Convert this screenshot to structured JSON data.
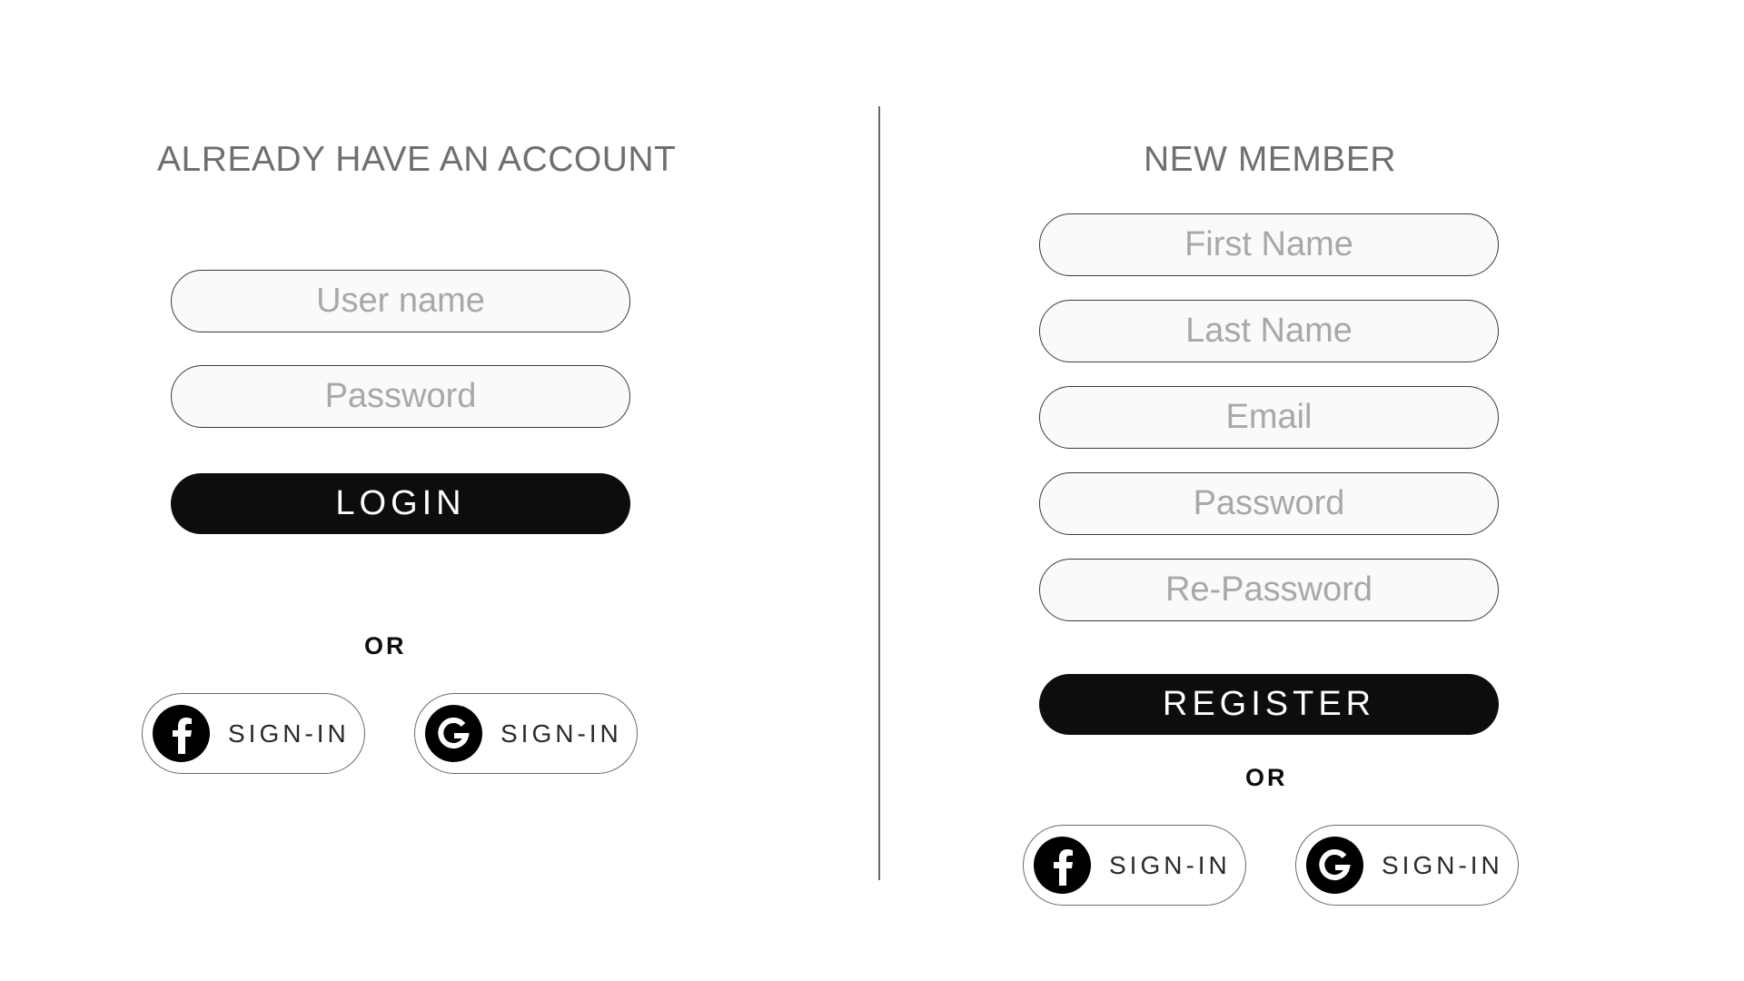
{
  "login": {
    "heading": "ALREADY HAVE AN ACCOUNT",
    "username_placeholder": "User name",
    "password_placeholder": "Password",
    "login_label": "LOGIN",
    "or_label": "OR",
    "facebook_label": "SIGN-IN",
    "google_label": "SIGN-IN"
  },
  "register": {
    "heading": "NEW MEMBER",
    "first_name_placeholder": "First Name",
    "last_name_placeholder": "Last Name",
    "email_placeholder": "Email",
    "password_placeholder": "Password",
    "repassword_placeholder": "Re-Password",
    "register_label": "REGISTER",
    "or_label": "OR",
    "facebook_label": "SIGN-IN",
    "google_label": "SIGN-IN"
  },
  "icons": {
    "facebook": "facebook-icon",
    "google": "google-icon"
  },
  "colors": {
    "primary_button": "#0d0d0d",
    "field_background": "#fbfaf8",
    "heading_text": "#6f6f6f",
    "placeholder_text": "#a8a8a8"
  }
}
